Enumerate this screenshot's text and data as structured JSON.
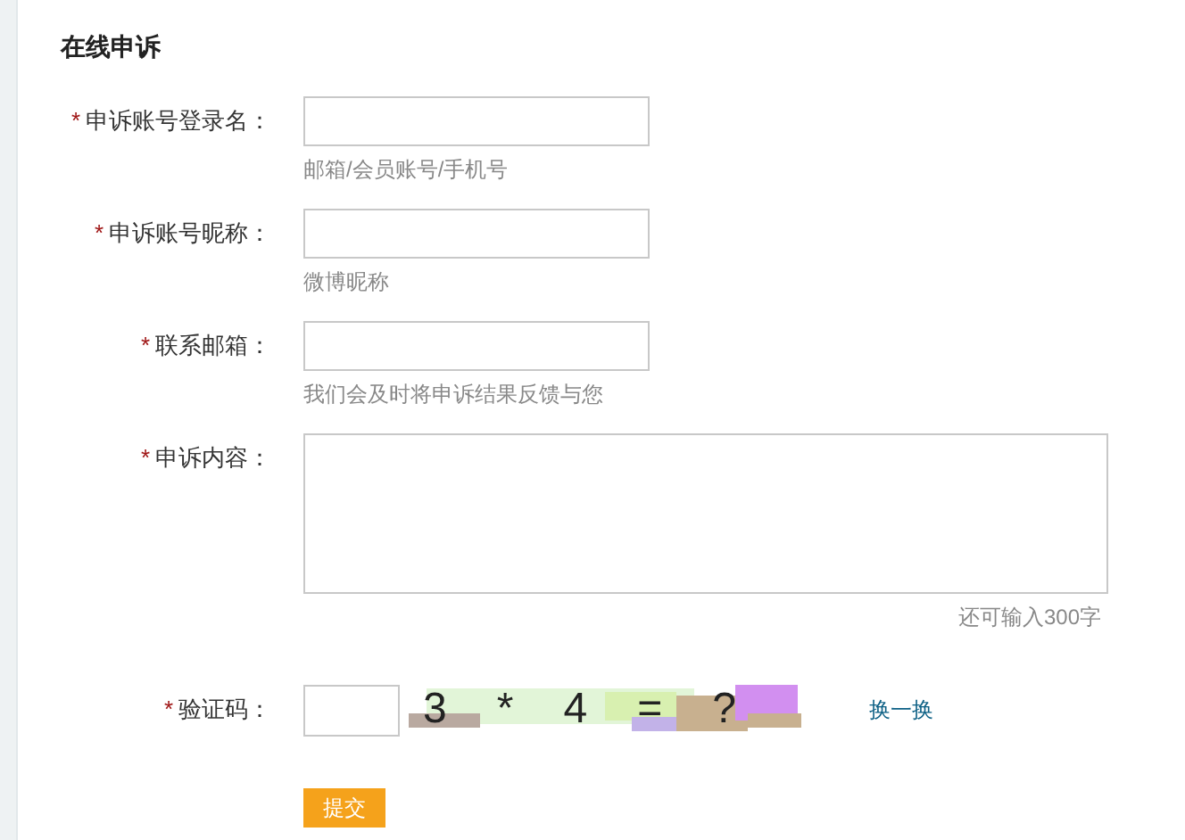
{
  "title": "在线申诉",
  "fields": [
    {
      "kind": "input",
      "required_mark": "*",
      "label": "申诉账号登录名：",
      "hint": "邮箱/会员账号/手机号"
    },
    {
      "kind": "input",
      "required_mark": "*",
      "label": "申诉账号昵称：",
      "hint": "微博昵称"
    },
    {
      "kind": "input",
      "required_mark": "*",
      "label": "联系邮箱：",
      "hint": "我们会及时将申诉结果反馈与您"
    },
    {
      "kind": "textarea",
      "required_mark": "*",
      "label": "申诉内容：",
      "hint": "还可输入300字"
    },
    {
      "kind": "captcha",
      "required_mark": "*",
      "label": "验证码：",
      "captcha_text": [
        "3",
        "*",
        "4",
        "=",
        "?"
      ],
      "refresh_link": "换一换"
    }
  ],
  "submit": "提交"
}
